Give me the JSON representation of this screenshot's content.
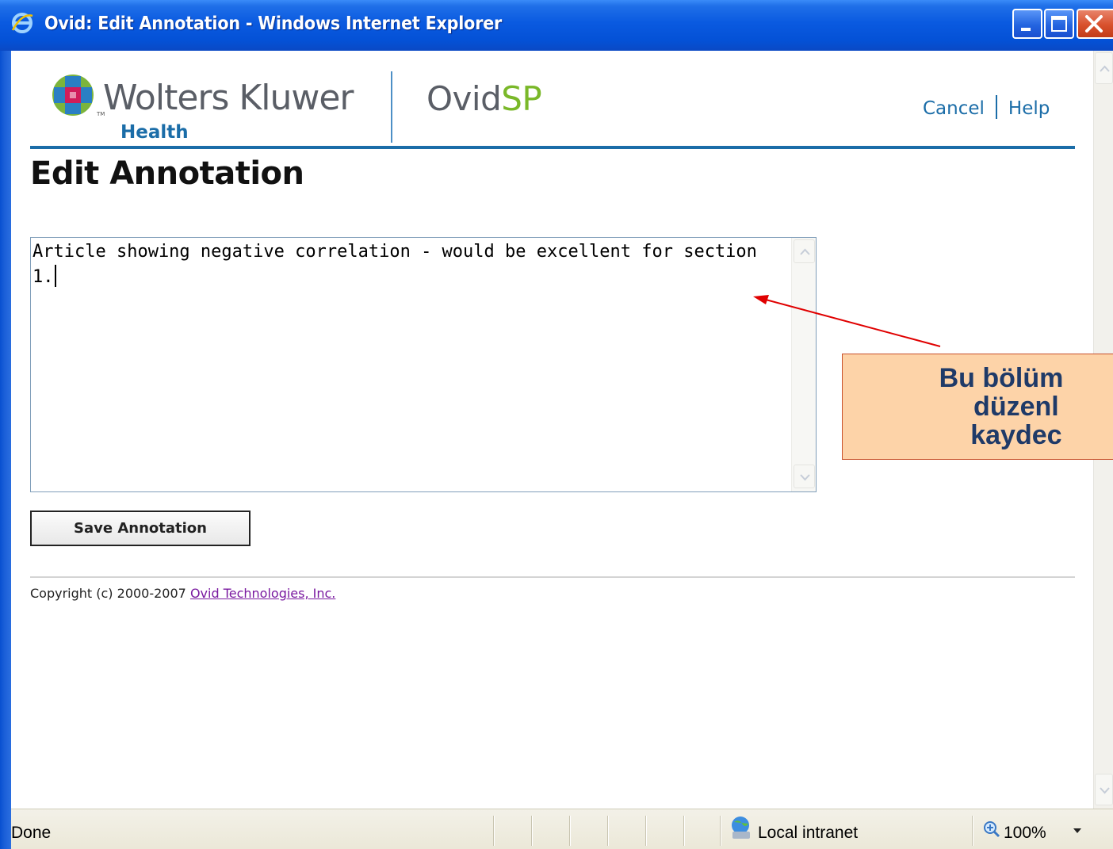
{
  "window": {
    "title": "Ovid: Edit Annotation - Windows Internet Explorer"
  },
  "header": {
    "brand_name": "Wolters Kluwer",
    "brand_sub": "Health",
    "brand_tm": "TM",
    "product_prefix": "Ovid",
    "product_suffix": "SP",
    "cancel_label": "Cancel",
    "help_label": "Help"
  },
  "main": {
    "page_title": "Edit Annotation",
    "annotation_text": "Article showing negative correlation - would be excellent for section 1.",
    "save_label": "Save Annotation"
  },
  "footer": {
    "copyright": "Copyright (c) 2000-2007 ",
    "company_link": "Ovid Technologies, Inc."
  },
  "callout": {
    "text": "Bu bölüm\n    düzenl\n    kaydec"
  },
  "statusbar": {
    "status": "Done",
    "zone": "Local intranet",
    "zoom": "100%"
  },
  "colors": {
    "brand_blue": "#1b6da8",
    "ovid_sp_green": "#7ab829",
    "callout_fill": "#fdd3a8",
    "callout_border": "#c8502a",
    "arrow_red": "#e00000",
    "link_purple": "#7a1aa0"
  },
  "icons": [
    "ie-icon",
    "minimize-icon",
    "maximize-icon",
    "close-icon",
    "wk-globe-icon",
    "local-intranet-icon",
    "zoom-icon",
    "chevron-down-icon"
  ]
}
